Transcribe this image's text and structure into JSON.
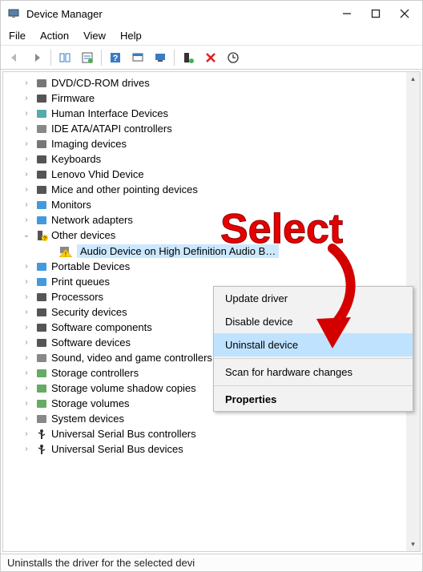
{
  "titlebar": {
    "title": "Device Manager"
  },
  "menubar": {
    "file": "File",
    "action": "Action",
    "view": "View",
    "help": "Help"
  },
  "tree": {
    "items": [
      {
        "label": "DVD/CD-ROM drives",
        "icon": "disc"
      },
      {
        "label": "Firmware",
        "icon": "chip"
      },
      {
        "label": "Human Interface Devices",
        "icon": "hid"
      },
      {
        "label": "IDE ATA/ATAPI controllers",
        "icon": "ide"
      },
      {
        "label": "Imaging devices",
        "icon": "camera"
      },
      {
        "label": "Keyboards",
        "icon": "keyboard"
      },
      {
        "label": "Lenovo Vhid Device",
        "icon": "keyboard"
      },
      {
        "label": "Mice and other pointing devices",
        "icon": "mouse"
      },
      {
        "label": "Monitors",
        "icon": "monitor"
      },
      {
        "label": "Network adapters",
        "icon": "net"
      },
      {
        "label": "Other devices",
        "icon": "unknown",
        "expanded": true
      },
      {
        "label": "Portable Devices",
        "icon": "portable"
      },
      {
        "label": "Print queues",
        "icon": "printer"
      },
      {
        "label": "Processors",
        "icon": "cpu"
      },
      {
        "label": "Security devices",
        "icon": "security"
      },
      {
        "label": "Software components",
        "icon": "soft"
      },
      {
        "label": "Software devices",
        "icon": "soft"
      },
      {
        "label": "Sound, video and game controllers",
        "icon": "sound"
      },
      {
        "label": "Storage controllers",
        "icon": "storage"
      },
      {
        "label": "Storage volume shadow copies",
        "icon": "storage"
      },
      {
        "label": "Storage volumes",
        "icon": "storage"
      },
      {
        "label": "System devices",
        "icon": "sys"
      },
      {
        "label": "Universal Serial Bus controllers",
        "icon": "usb"
      },
      {
        "label": "Universal Serial Bus devices",
        "icon": "usb"
      }
    ],
    "child": {
      "label": "Audio Device on High Definition Audio B…",
      "icon": "warn"
    }
  },
  "context_menu": {
    "update": "Update driver",
    "disable": "Disable device",
    "uninstall": "Uninstall device",
    "scan": "Scan for hardware changes",
    "properties": "Properties"
  },
  "statusbar": {
    "text": "Uninstalls the driver for the selected devi"
  },
  "annotation": {
    "text": "Select"
  }
}
